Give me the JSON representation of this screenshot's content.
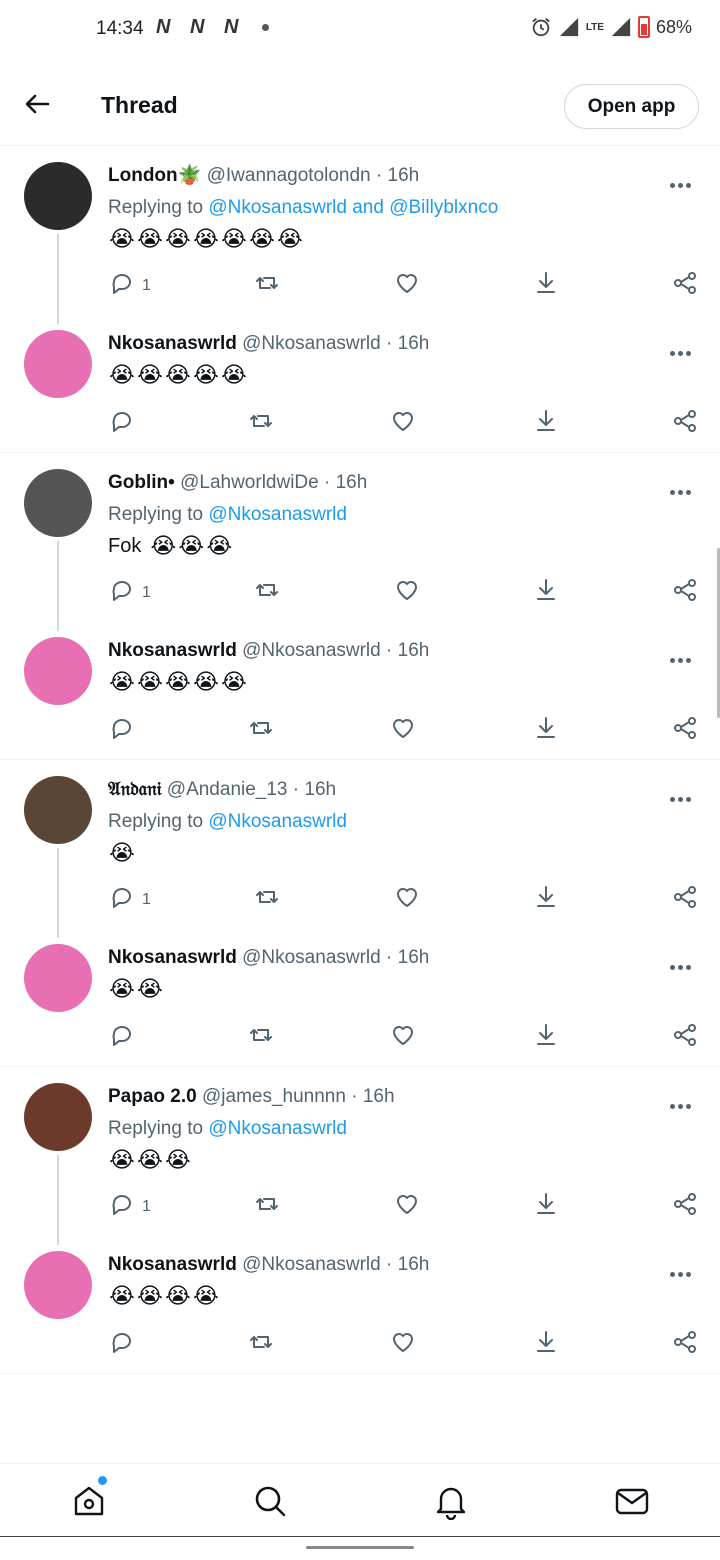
{
  "status_bar": {
    "time": "14:34",
    "carrier_icons": [
      "N",
      "N",
      "N"
    ],
    "lte_label": "LTE",
    "battery": "68%"
  },
  "header": {
    "title": "Thread",
    "open_app_label": "Open app"
  },
  "tweets": [
    {
      "name": "London",
      "name_emoji": "🪴",
      "handle": "@Iwannagotolondn",
      "time": "· 16h",
      "replying_label": "Replying to",
      "replying_to": "@Nkosanaswrld and @Billyblxnco",
      "text": "",
      "emoji_count": 7,
      "reply_count": "1",
      "avatar_color": "#2b2b2b"
    },
    {
      "name": "Nkosanaswrld",
      "handle": "@Nkosanaswrld",
      "time": "· 16h",
      "text": "",
      "emoji_count": 5,
      "reply_count": "",
      "avatar_color": "#e86fb3"
    },
    {
      "name": "Goblin•",
      "handle": "@LahworldwiDe",
      "time": "· 16h",
      "replying_label": "Replying to",
      "replying_to": "@Nkosanaswrld",
      "text": "Fok",
      "emoji_count": 3,
      "reply_count": "1",
      "avatar_color": "#555"
    },
    {
      "name": "Nkosanaswrld",
      "handle": "@Nkosanaswrld",
      "time": "· 16h",
      "text": "",
      "emoji_count": 5,
      "reply_count": "",
      "avatar_color": "#e86fb3"
    },
    {
      "name": "𝔄𝔫𝔡𝔞𝔫𝔦",
      "handle": "@Andanie_13",
      "time": "· 16h",
      "replying_label": "Replying to",
      "replying_to": "@Nkosanaswrld",
      "text": "",
      "emoji_count": 1,
      "reply_count": "1",
      "avatar_color": "#5a4636"
    },
    {
      "name": "Nkosanaswrld",
      "handle": "@Nkosanaswrld",
      "time": "· 16h",
      "text": "",
      "emoji_count": 2,
      "reply_count": "",
      "avatar_color": "#e86fb3"
    },
    {
      "name": "Papao 2.0",
      "handle": "@james_hunnnn",
      "time": "· 16h",
      "replying_label": "Replying to",
      "replying_to": "@Nkosanaswrld",
      "text": "",
      "emoji_count": 3,
      "reply_count": "1",
      "avatar_color": "#6b3a2a"
    },
    {
      "name": "Nkosanaswrld",
      "handle": "@Nkosanaswrld",
      "time": "· 16h",
      "text": "",
      "emoji_count": 4,
      "reply_count": "",
      "avatar_color": "#e86fb3"
    }
  ],
  "emoji_char": "😭",
  "icons": {
    "reply": "reply-icon",
    "retweet": "retweet-icon",
    "like": "heart-icon",
    "download": "download-icon",
    "share": "share-icon",
    "more": "more-icon"
  },
  "bottom_nav": [
    "home-icon",
    "search-icon",
    "bell-icon",
    "mail-icon"
  ],
  "colors": {
    "accent": "#1d9bf0",
    "text": "#0f1419",
    "muted": "#536471"
  }
}
